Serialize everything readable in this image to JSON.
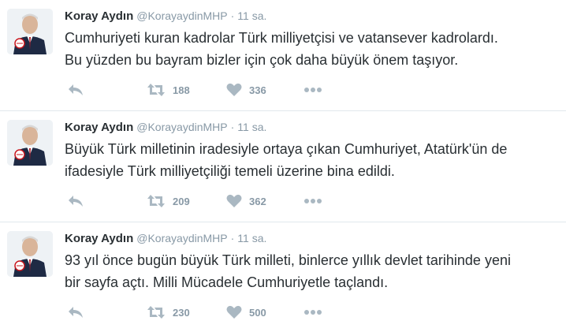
{
  "colors": {
    "text": "#292f33",
    "muted": "#8899a6",
    "divider": "#e1e8ed",
    "icon": "#aab8c2"
  },
  "icons": {
    "reply": "reply-icon",
    "retweet": "retweet-icon",
    "like": "heart-icon",
    "more": "more-icon"
  },
  "tweets": [
    {
      "name": "Koray Aydın",
      "handle": "@KorayaydinMHP",
      "dot": "·",
      "time": "11 sa.",
      "lines": [
        "Cumhuriyeti kuran kadrolar Türk milliyetçisi ve vatansever kadrolardı.",
        "Bu yüzden bu bayram bizler için çok daha büyük önem taşıyor."
      ],
      "retweets": "188",
      "likes": "336"
    },
    {
      "name": "Koray Aydın",
      "handle": "@KorayaydinMHP",
      "dot": "·",
      "time": "11 sa.",
      "lines": [
        "Büyük Türk milletinin iradesiyle ortaya çıkan Cumhuriyet, Atatürk'ün de",
        "ifadesiyle Türk milliyetçiliği temeli üzerine bina edildi."
      ],
      "retweets": "209",
      "likes": "362"
    },
    {
      "name": "Koray Aydın",
      "handle": "@KorayaydinMHP",
      "dot": "·",
      "time": "11 sa.",
      "lines": [
        "93 yıl önce bugün büyük Türk milleti, binlerce yıllık devlet tarihinde yeni",
        "bir sayfa açtı. Milli Mücadele Cumhuriyetle taçlandı."
      ],
      "retweets": "230",
      "likes": "500"
    }
  ]
}
